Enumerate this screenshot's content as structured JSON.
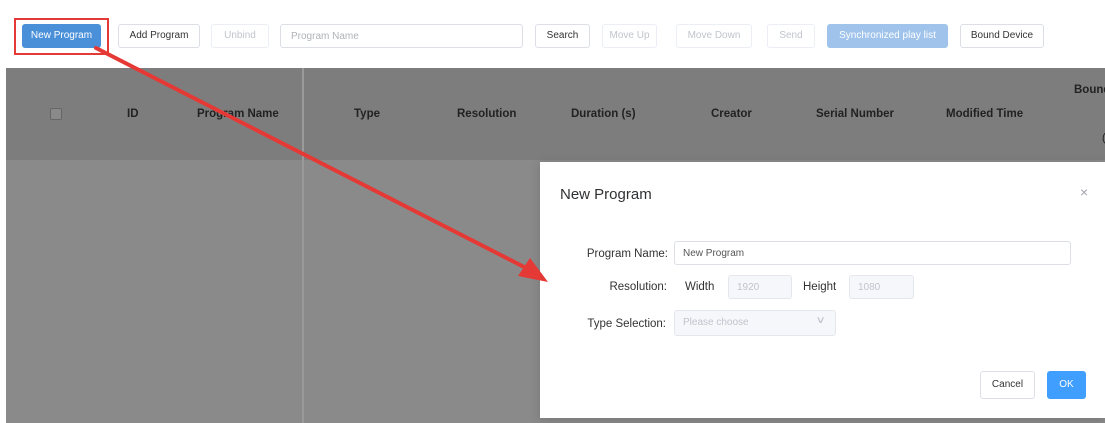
{
  "toolbar": {
    "new_program": "New Program",
    "add_program": "Add Program",
    "unbind": "Unbind",
    "search_placeholder": "Program Name",
    "search": "Search",
    "move_up": "Move Up",
    "move_down": "Move Down",
    "send": "Send",
    "synchronized_play_list": "Synchronized play list",
    "bound_device": "Bound Device"
  },
  "table": {
    "columns": [
      "ID",
      "Program Name",
      "Type",
      "Resolution",
      "Duration (s)",
      "Creator",
      "Serial Number",
      "Modified Time",
      "Bound"
    ],
    "cut_sub": "("
  },
  "modal": {
    "title": "New Program",
    "close_glyph": "×",
    "program_name_label": "Program Name:",
    "program_name_value": "New Program",
    "resolution_label": "Resolution:",
    "width_label": "Width",
    "width_value": "1920",
    "height_label": "Height",
    "height_value": "1080",
    "type_label": "Type Selection:",
    "type_placeholder": "Please choose",
    "chevron_glyph": "∨",
    "cancel": "Cancel",
    "ok": "OK"
  },
  "annotation": {
    "color": "#e53935"
  },
  "colors": {
    "primary": "#4a90d9",
    "overlay_gray": "#8a8a8a",
    "ok_blue": "#409eff"
  }
}
